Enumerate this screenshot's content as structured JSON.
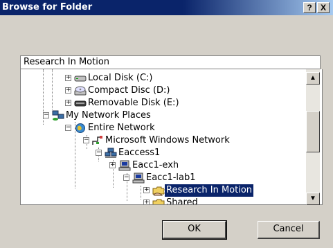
{
  "window": {
    "title": "Browse for Folder",
    "help_label": "?",
    "close_label": "X"
  },
  "path_field": {
    "value": "Research In Motion"
  },
  "tree": {
    "items": [
      {
        "label": "Local Disk (C:)",
        "icon": "hard-disk-icon",
        "expander": "+"
      },
      {
        "label": "Compact Disc (D:)",
        "icon": "cd-drive-icon",
        "expander": "+"
      },
      {
        "label": "Removable Disk (E:)",
        "icon": "removable-disk-icon",
        "expander": "+"
      },
      {
        "label": "My Network Places",
        "icon": "network-places-icon",
        "expander": "−"
      },
      {
        "label": "Entire Network",
        "icon": "globe-icon",
        "expander": "−"
      },
      {
        "label": "Microsoft Windows Network",
        "icon": "network-cable-icon",
        "expander": "−"
      },
      {
        "label": "Eaccess1",
        "icon": "workgroup-icon",
        "expander": "−"
      },
      {
        "label": "Eacc1-exh",
        "icon": "computer-icon",
        "expander": "+"
      },
      {
        "label": "Eacc1-lab1",
        "icon": "computer-icon",
        "expander": "−"
      },
      {
        "label": "Research In Motion",
        "icon": "shared-folder-icon",
        "expander": "+",
        "selected": true
      },
      {
        "label": "Shared",
        "icon": "shared-folder-icon",
        "expander": "+"
      }
    ]
  },
  "buttons": {
    "ok": "OK",
    "cancel": "Cancel"
  },
  "colors": {
    "title_bar": "#0a246a",
    "selection": "#0a246a",
    "face": "#d4d0c8"
  }
}
